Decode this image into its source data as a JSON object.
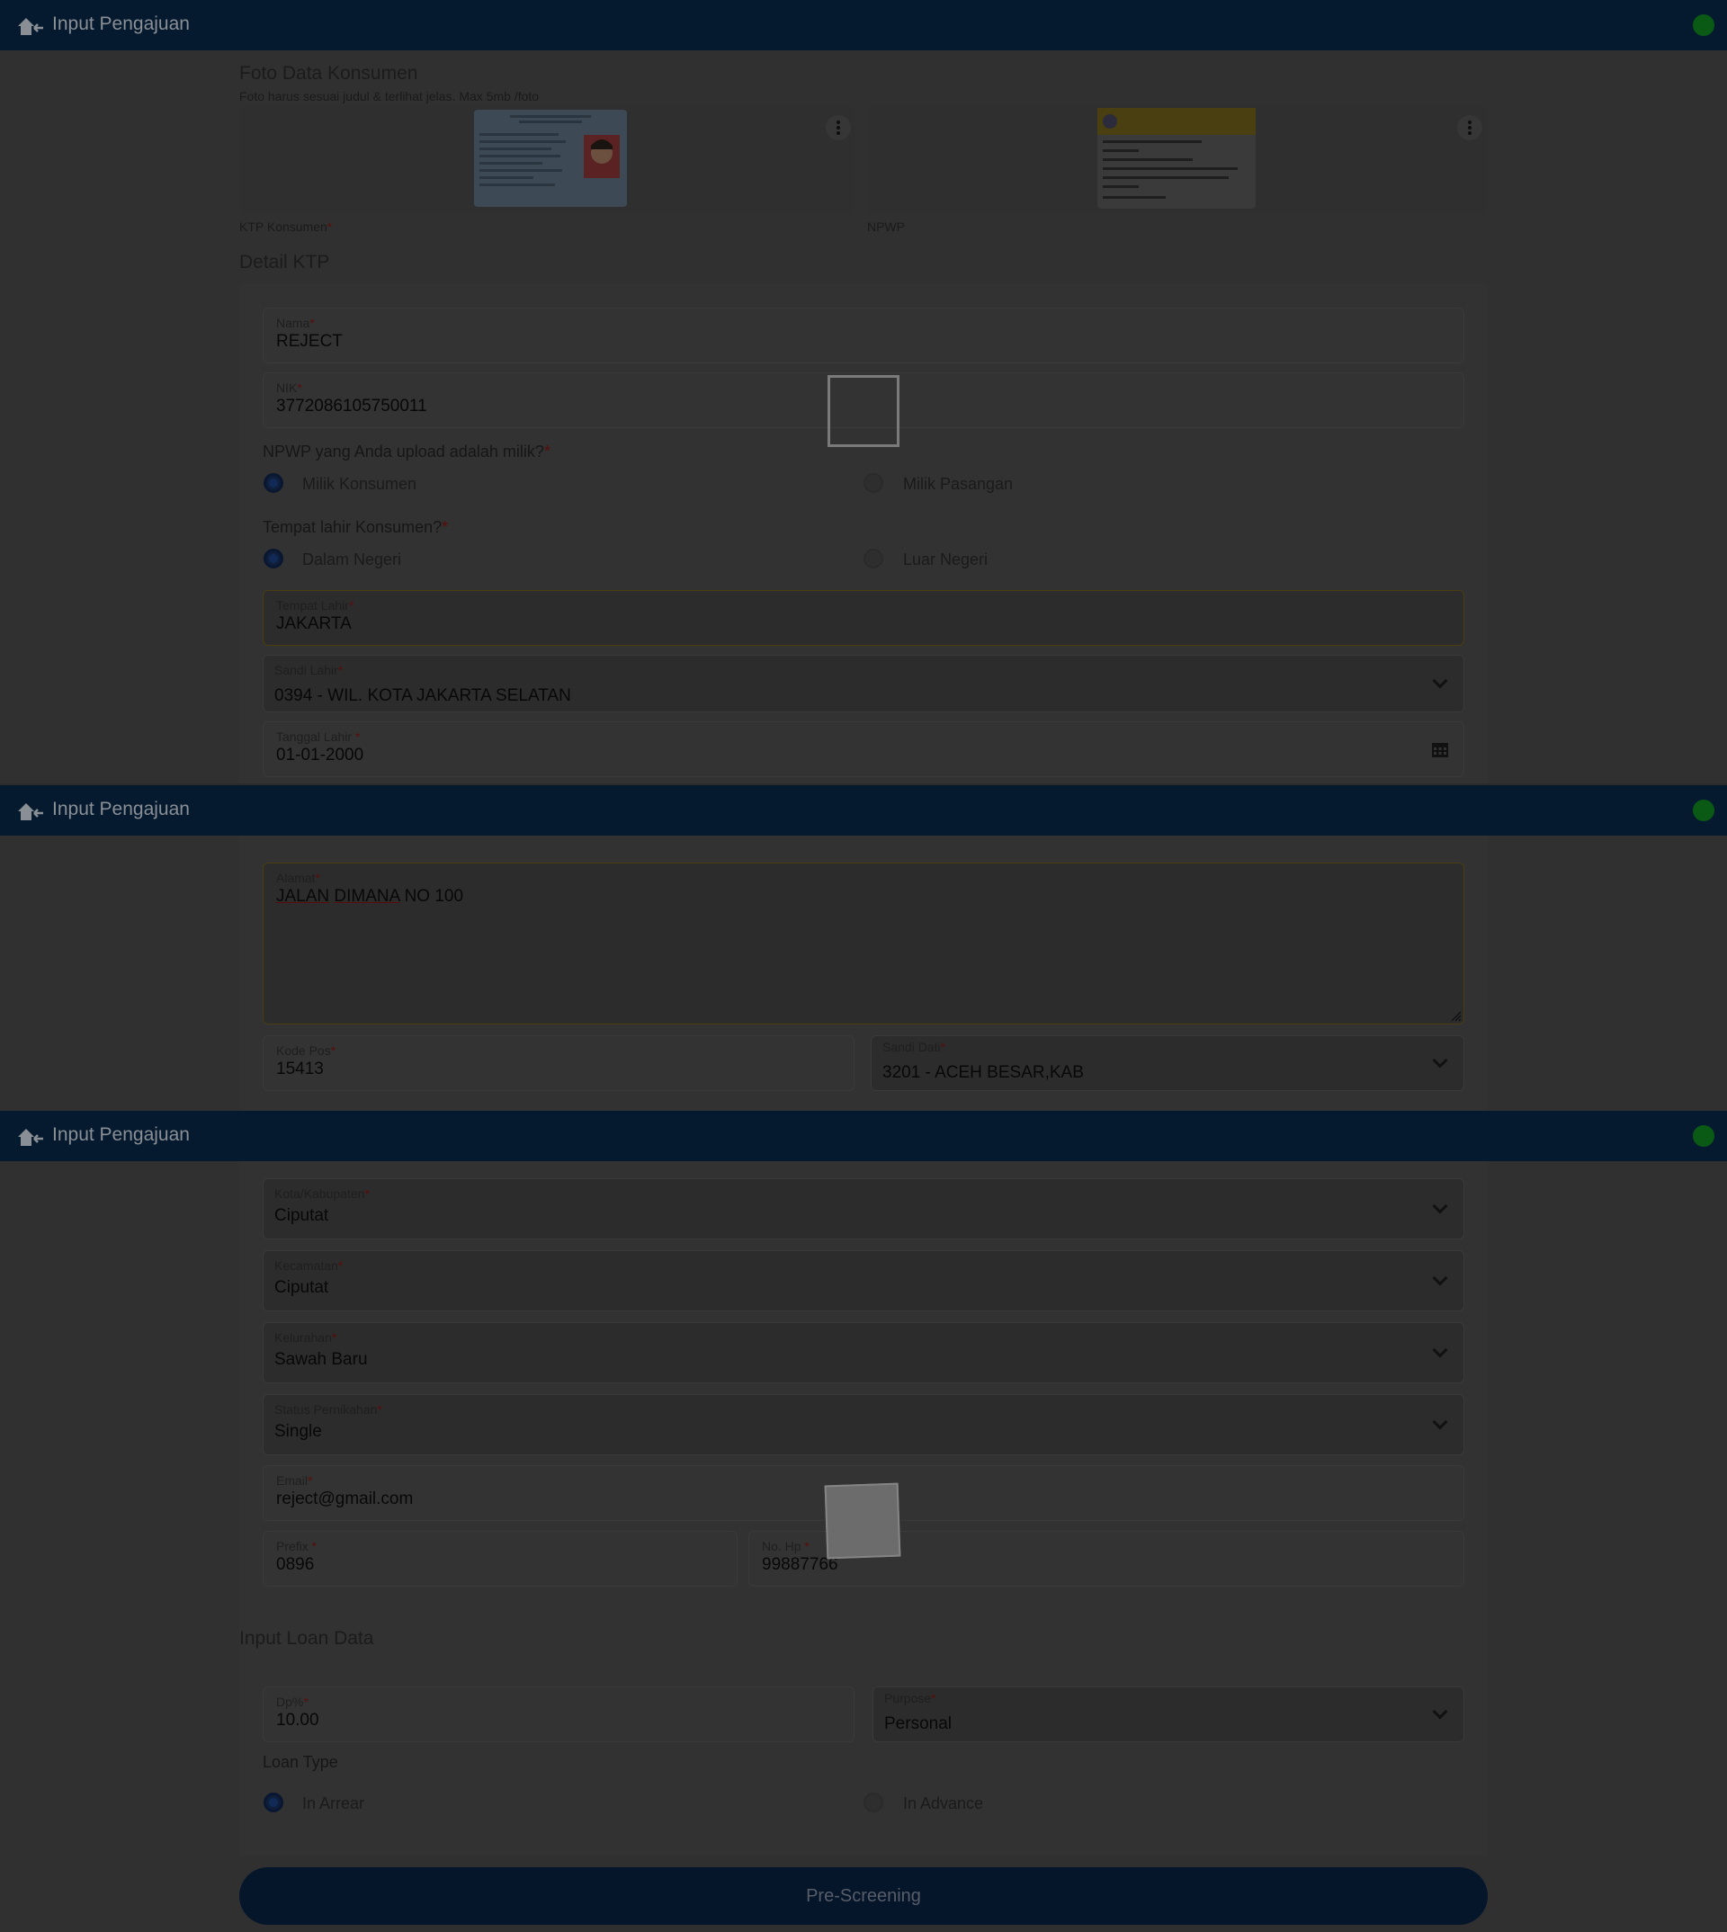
{
  "app": {
    "title": "Input Pengajuan"
  },
  "photos": {
    "section_title": "Foto Data Konsumen",
    "hint": "Foto harus sesuai judul & terlihat jelas. Max 5mb /foto",
    "ktp_label": "KTP Konsumen",
    "npwp_label": "NPWP"
  },
  "ktp": {
    "section_title": "Detail KTP",
    "nama": {
      "label": "Nama",
      "value": "REJECT"
    },
    "nik": {
      "label": "NIK",
      "value": "3772086105750011"
    },
    "npwp_owner": {
      "question": "NPWP yang Anda upload adalah milik?",
      "options": [
        "Milik Konsumen",
        "Milik Pasangan"
      ],
      "selected": 0
    },
    "birthplace_type": {
      "question": "Tempat lahir Konsumen?",
      "options": [
        "Dalam Negeri",
        "Luar Negeri"
      ],
      "selected": 0
    },
    "tempat_lahir": {
      "label": "Tempat Lahir",
      "value": "JAKARTA"
    },
    "sandi_lahir": {
      "label": "Sandi Lahir",
      "value": "0394 - WIL. KOTA JAKARTA SELATAN"
    },
    "tanggal_lahir": {
      "label": "Tanggal Lahir",
      "value": "01-01-2000"
    },
    "alamat": {
      "label": "Alamat",
      "value_w1": "JALAN",
      "value_w2": "DIMANA",
      "value_rest": "NO 100"
    },
    "kode_pos": {
      "label": "Kode Pos",
      "value": "15413"
    },
    "sandi_dati": {
      "label": "Sandi Dati",
      "value": "3201 - ACEH BESAR,KAB"
    },
    "kota": {
      "label": "Kota/Kabupaten",
      "value": "Ciputat"
    },
    "kecamatan": {
      "label": "Kecamatan",
      "value": "Ciputat"
    },
    "kelurahan": {
      "label": "Kelurahan",
      "value": "Sawah Baru"
    },
    "status": {
      "label": "Status Pernikahan",
      "value": "Single"
    },
    "email": {
      "label": "Email",
      "value": "reject@gmail.com"
    },
    "prefix": {
      "label": "Prefix",
      "value": "0896"
    },
    "nohp": {
      "label": "No. Hp",
      "value": "99887766"
    }
  },
  "loan": {
    "section_title": "Input Loan Data",
    "dp": {
      "label": "Dp%",
      "value": "10.00"
    },
    "purpose": {
      "label": "Purpose",
      "value": "Personal"
    },
    "loan_type": {
      "question": "Loan Type",
      "options": [
        "In Arrear",
        "In Advance"
      ],
      "selected": 0
    }
  },
  "actions": {
    "submit": "Pre-Screening"
  },
  "colors": {
    "appbar": "#051a2e",
    "status_dot": "#0a5a16",
    "button": "#05152a",
    "radio_selected": "#102a55"
  },
  "icons": {
    "home": "home-back-icon",
    "calendar": "calendar-icon",
    "chevron": "chevron-down-icon",
    "more": "more-vertical-icon"
  }
}
